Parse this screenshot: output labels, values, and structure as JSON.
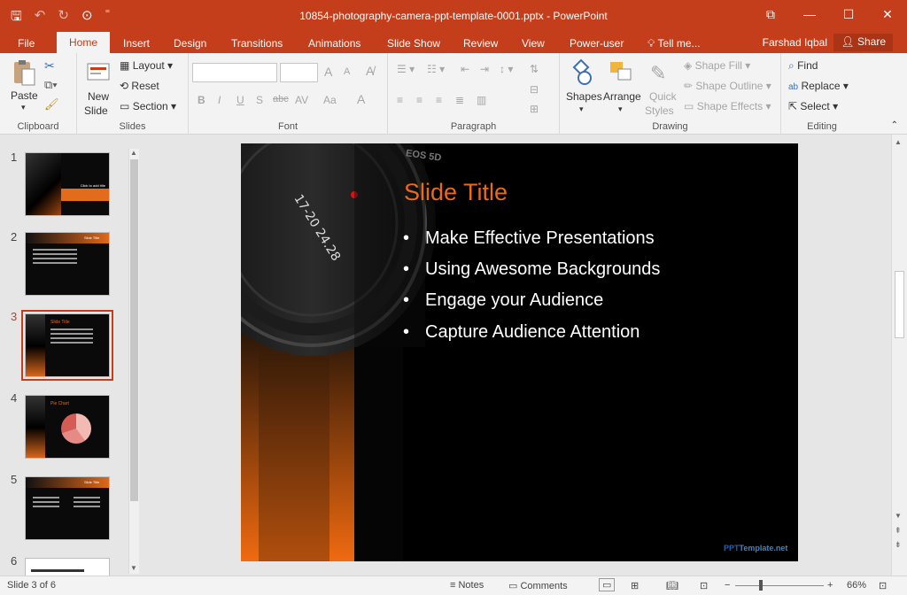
{
  "app": {
    "window_title": "10854-photography-camera-ppt-template-0001.pptx - PowerPoint",
    "user_name": "Farshad Iqbal",
    "share_label": "Share",
    "tell_me": "Tell me...",
    "accent": "#c43e1c"
  },
  "qat": {
    "icons": [
      "save-icon",
      "undo-icon",
      "redo-icon",
      "start-from-beginning-icon",
      "customize-icon"
    ]
  },
  "tabs": [
    {
      "label": "File"
    },
    {
      "label": "Home"
    },
    {
      "label": "Insert"
    },
    {
      "label": "Design"
    },
    {
      "label": "Transitions"
    },
    {
      "label": "Animations"
    },
    {
      "label": "Slide Show"
    },
    {
      "label": "Review"
    },
    {
      "label": "View"
    },
    {
      "label": "Power-user"
    }
  ],
  "ribbon": {
    "clipboard": {
      "label": "Clipboard",
      "paste": "Paste"
    },
    "slides": {
      "label": "Slides",
      "new_slide_1": "New",
      "new_slide_2": "Slide",
      "layout": "Layout",
      "reset": "Reset",
      "section": "Section"
    },
    "font": {
      "label": "Font",
      "bold": "B",
      "italic": "I",
      "underline": "U",
      "shadow": "S",
      "strike": "abc",
      "spacing": "AV",
      "case": "Aa",
      "grow": "A",
      "shrink": "A"
    },
    "paragraph": {
      "label": "Paragraph"
    },
    "drawing": {
      "label": "Drawing",
      "shapes": "Shapes",
      "arrange": "Arrange",
      "quick_styles_1": "Quick",
      "quick_styles_2": "Styles",
      "shape_fill": "Shape Fill",
      "shape_outline": "Shape Outline",
      "shape_effects": "Shape Effects"
    },
    "editing": {
      "label": "Editing",
      "find": "Find",
      "replace": "Replace",
      "select": "Select"
    }
  },
  "thumbnails": [
    {
      "num": "1",
      "text": "Click to add title"
    },
    {
      "num": "2",
      "text": "Slide Title"
    },
    {
      "num": "3",
      "text": "Slide Title"
    },
    {
      "num": "4",
      "text": "Pie Chart"
    },
    {
      "num": "5",
      "text": "Slide Title"
    },
    {
      "num": "6",
      "text": ""
    }
  ],
  "slide": {
    "title": "Slide Title",
    "bullets": [
      "Make Effective Presentations",
      "Using Awesome Backgrounds",
      "Engage your Audience",
      "Capture Audience Attention"
    ],
    "lens_text": "17-20 24.28",
    "camera_brand": "EOS 5D",
    "footer_a": "PPT",
    "footer_b": "Template.net",
    "title_color": "#e86a1d"
  },
  "status": {
    "slide_info": "Slide 3 of 6",
    "notes": "Notes",
    "comments": "Comments",
    "zoom": "66%",
    "zoom_level": 0.66
  }
}
